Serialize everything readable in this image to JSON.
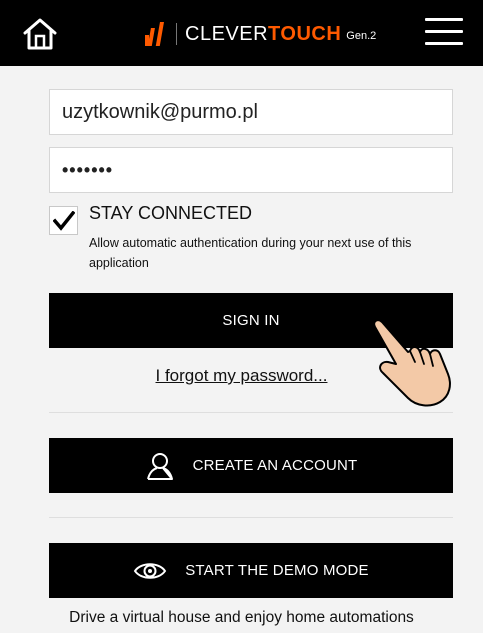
{
  "header": {
    "logo_clever": "CLEVER",
    "logo_touch": "TOUCH",
    "logo_gen": "Gen.2",
    "brand_color": "#ff5a00"
  },
  "login": {
    "email_value": "uzytkownik@purmo.pl",
    "password_value": "•••••••",
    "stay_connected_checked": true,
    "stay_connected_label": "STAY CONNECTED",
    "stay_connected_desc": "Allow automatic authentication during your next use of this application",
    "sign_in_label": "SIGN IN",
    "forgot_label": "I forgot my password..."
  },
  "account": {
    "create_label": "CREATE AN ACCOUNT"
  },
  "demo": {
    "start_label": "START THE DEMO MODE",
    "note": "Drive a virtual house and enjoy home automations"
  },
  "icons": {
    "home": "home-icon",
    "menu": "hamburger-menu-icon",
    "user": "user-icon",
    "eye": "eye-icon",
    "check": "checkmark-icon",
    "pointer": "hand-pointer-icon"
  }
}
